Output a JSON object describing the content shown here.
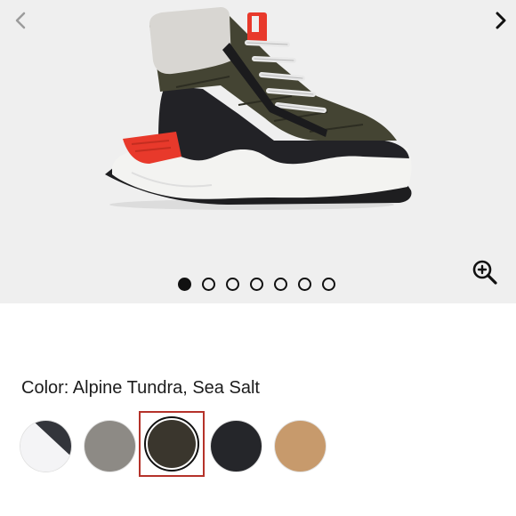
{
  "gallery": {
    "prev_icon": "chevron-left-icon",
    "next_icon": "chevron-right-icon",
    "zoom_icon": "zoom-in-icon",
    "slide_count": 7,
    "active_slide": 1,
    "background": "#efefef"
  },
  "color": {
    "label": "Color: Alpine Tundra, Sea Salt",
    "selected_index": 2
  },
  "swatches": [
    {
      "colors": [
        "#33353b",
        "#f4f4f6"
      ]
    },
    {
      "colors": [
        "#8d8a85"
      ]
    },
    {
      "colors": [
        "#3a362d"
      ]
    },
    {
      "colors": [
        "#25262a"
      ]
    },
    {
      "colors": [
        "#c79a6c"
      ]
    }
  ],
  "colors": {
    "selected_border": "#b5322a",
    "accent_red": "#e8392b",
    "upper_olive": "#444433"
  }
}
